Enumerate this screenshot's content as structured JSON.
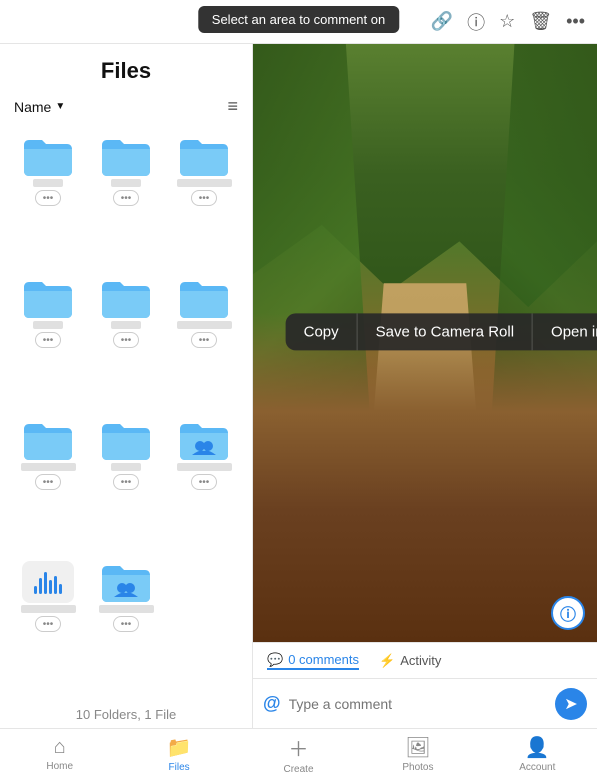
{
  "topBar": {
    "tooltip": "Select an area to comment on",
    "icons": [
      "link",
      "info-circle",
      "star",
      "trash",
      "ellipsis"
    ]
  },
  "leftPanel": {
    "title": "Files",
    "sortLabel": "Name",
    "folders": [
      {
        "name": "",
        "type": "folder",
        "nameWidth": "short"
      },
      {
        "name": "",
        "type": "folder",
        "nameWidth": "short"
      },
      {
        "name": "",
        "type": "folder",
        "nameWidth": "medium"
      },
      {
        "name": "",
        "type": "folder",
        "nameWidth": "short"
      },
      {
        "name": "",
        "type": "folder",
        "nameWidth": "short"
      },
      {
        "name": "",
        "type": "folder",
        "nameWidth": "medium"
      },
      {
        "name": "",
        "type": "folder",
        "nameWidth": "medium"
      },
      {
        "name": "",
        "type": "folder",
        "nameWidth": "short"
      },
      {
        "name": "",
        "type": "folder-shared",
        "nameWidth": "medium"
      },
      {
        "name": "",
        "type": "audio",
        "nameWidth": "medium"
      },
      {
        "name": "",
        "type": "folder-shared",
        "nameWidth": "medium"
      }
    ],
    "countLabel": "10 Folders, 1 File"
  },
  "contextMenu": {
    "items": [
      "Copy",
      "Save to Camera Roll",
      "Open in..."
    ]
  },
  "commentsBar": {
    "commentsLabel": "0 comments",
    "activityLabel": "Activity"
  },
  "commentInput": {
    "placeholder": "Type a comment"
  },
  "bottomNav": {
    "items": [
      {
        "label": "Home",
        "icon": "house",
        "active": false
      },
      {
        "label": "Files",
        "icon": "folder",
        "active": true
      },
      {
        "label": "Create",
        "icon": "plus",
        "active": false
      },
      {
        "label": "Photos",
        "icon": "person",
        "active": false
      },
      {
        "label": "Account",
        "icon": "person-circle",
        "active": false
      }
    ]
  }
}
